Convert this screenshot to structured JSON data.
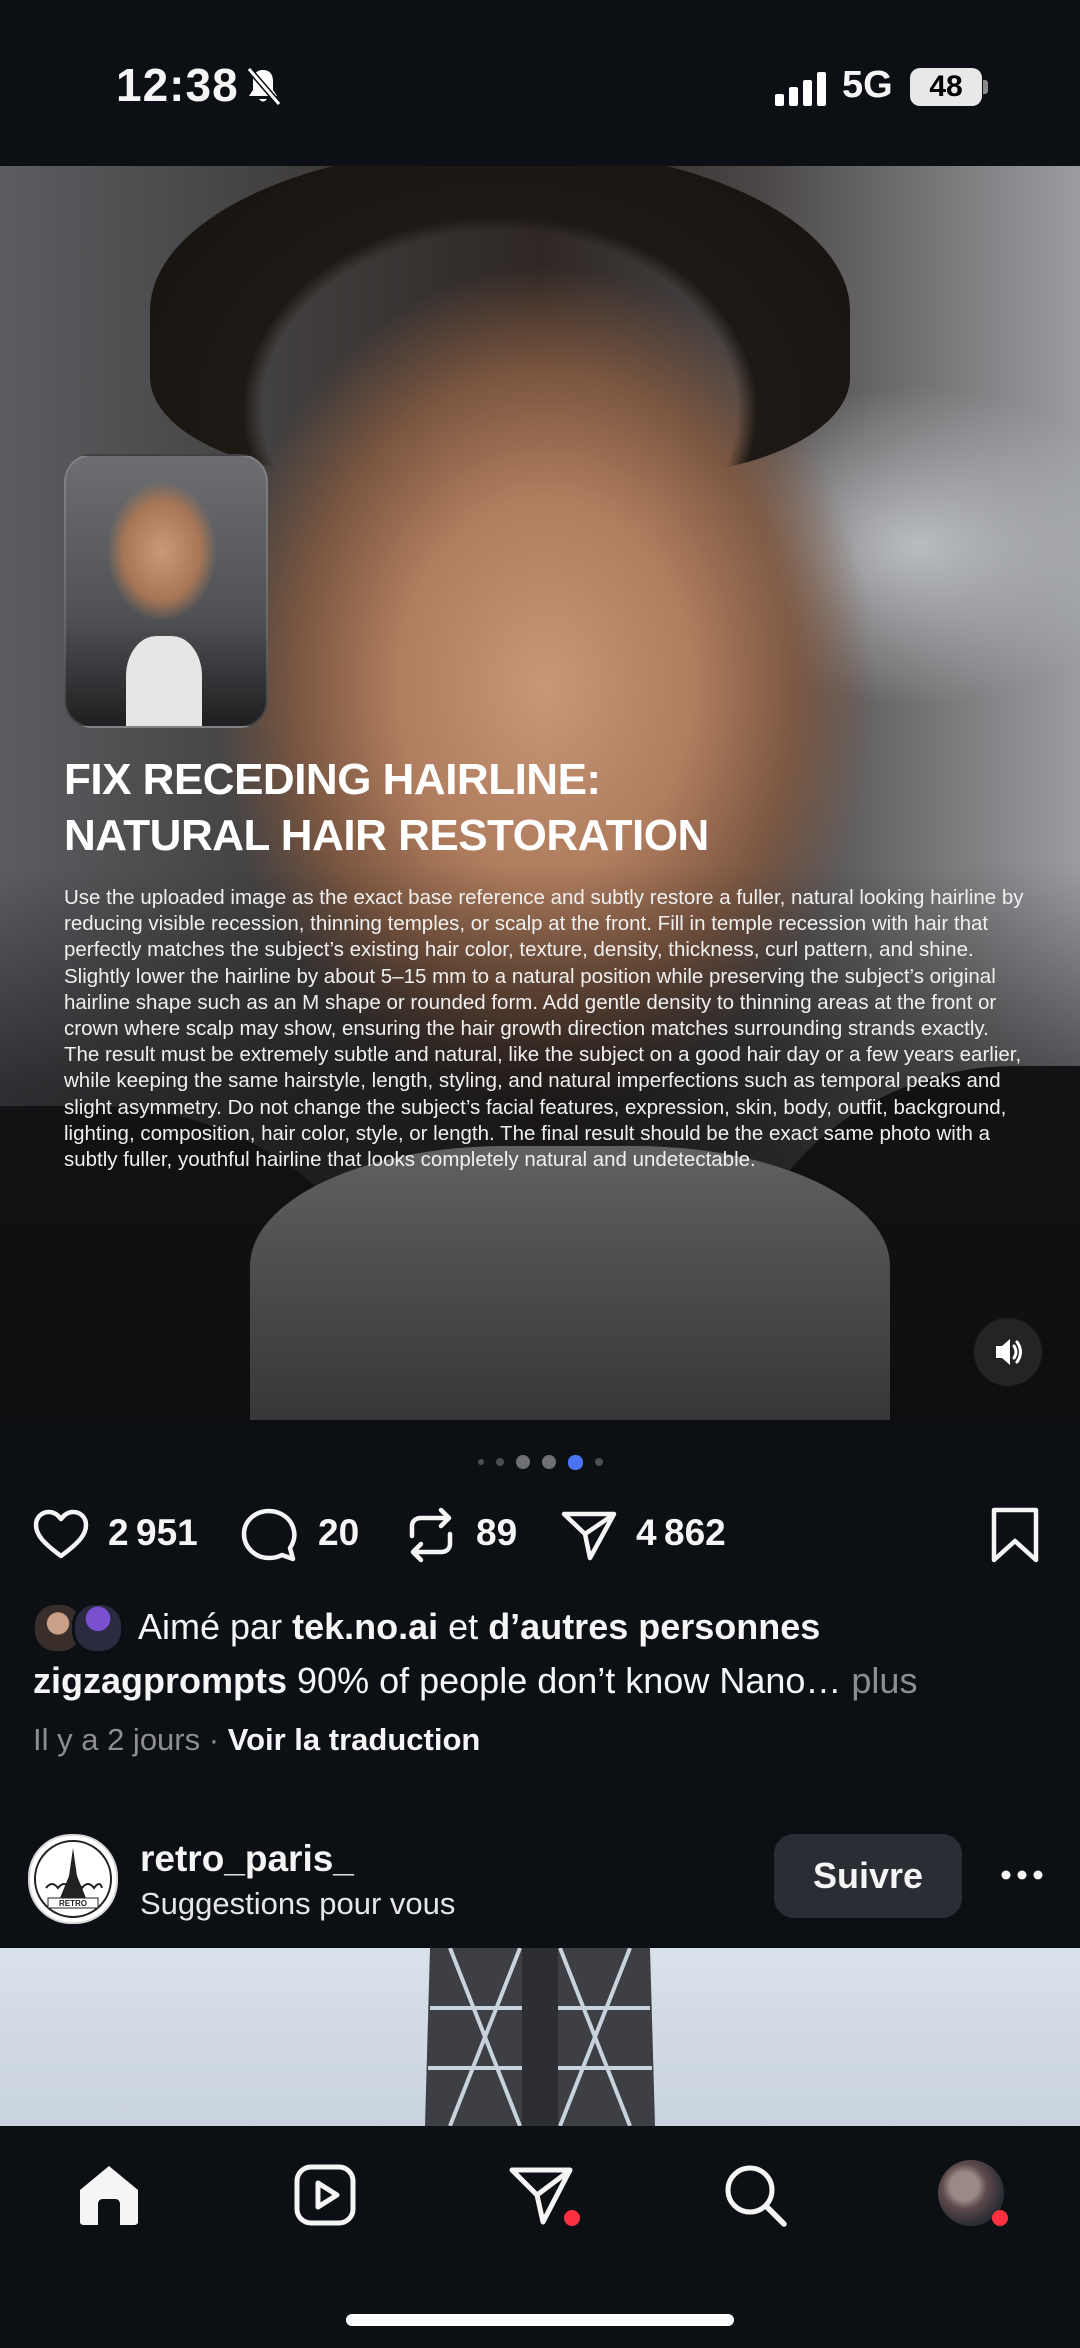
{
  "status_bar": {
    "time": "12:38",
    "network": "5G",
    "battery": "48"
  },
  "post": {
    "headline_line1": "FIX RECEDING HAIRLINE:",
    "headline_line2": "NATURAL HAIR RESTORATION",
    "body": "Use the uploaded image as the exact base reference and subtly restore a fuller, natural looking hairline by reducing visible recession, thinning temples, or scalp at the front. Fill in temple recession with hair that perfectly matches the subject’s existing hair color, texture, density, thickness, curl pattern, and shine. Slightly lower the hairline by about 5–15 mm to a natural position while preserving the subject’s original hairline shape such as an M shape or rounded form. Add gentle density to thinning areas at the front or crown where scalp may show, ensuring the hair growth direction matches surrounding strands exactly. The result must be extremely subtle and natural, like the subject on a good hair day or a few years earlier, while keeping the same hairstyle, length, styling, and natural imperfections such as temporal peaks and slight asymmetry. Do not change the subject’s facial features, expression, skin, body, outfit, background, lighting, composition, hair color, style, or length. The final result should be the exact same photo with a subtly fuller, youthful hairline that looks completely natural and undetectable.",
    "carousel": {
      "total": 6,
      "active_index": 4
    },
    "actions": {
      "likes": "2 951",
      "comments": "20",
      "reposts": "89",
      "shares": "4 862"
    },
    "liked_by_prefix": "Aimé par",
    "liked_by_user": "tek.no.ai",
    "liked_by_joiner": "et",
    "liked_by_others": "d’autres personnes",
    "caption_user": "zigzagprompts",
    "caption_text": "90% of people don’t know Nano…",
    "caption_more": "plus",
    "time_ago": "Il y a 2 jours",
    "separator": "·",
    "translate_label": "Voir la traduction"
  },
  "next_post": {
    "username": "retro_paris_",
    "subtitle": "Suggestions pour vous",
    "follow_label": "Suivre",
    "avatar_text": "RETRO"
  },
  "nav": {
    "items": [
      "home-icon",
      "reels-icon",
      "direct-icon",
      "search-icon",
      "profile-avatar"
    ],
    "badge_color": "#ff3040"
  },
  "colors": {
    "background": "#0c1014",
    "active_dot": "#4b74f5",
    "muted_text": "#8e8e8e"
  }
}
